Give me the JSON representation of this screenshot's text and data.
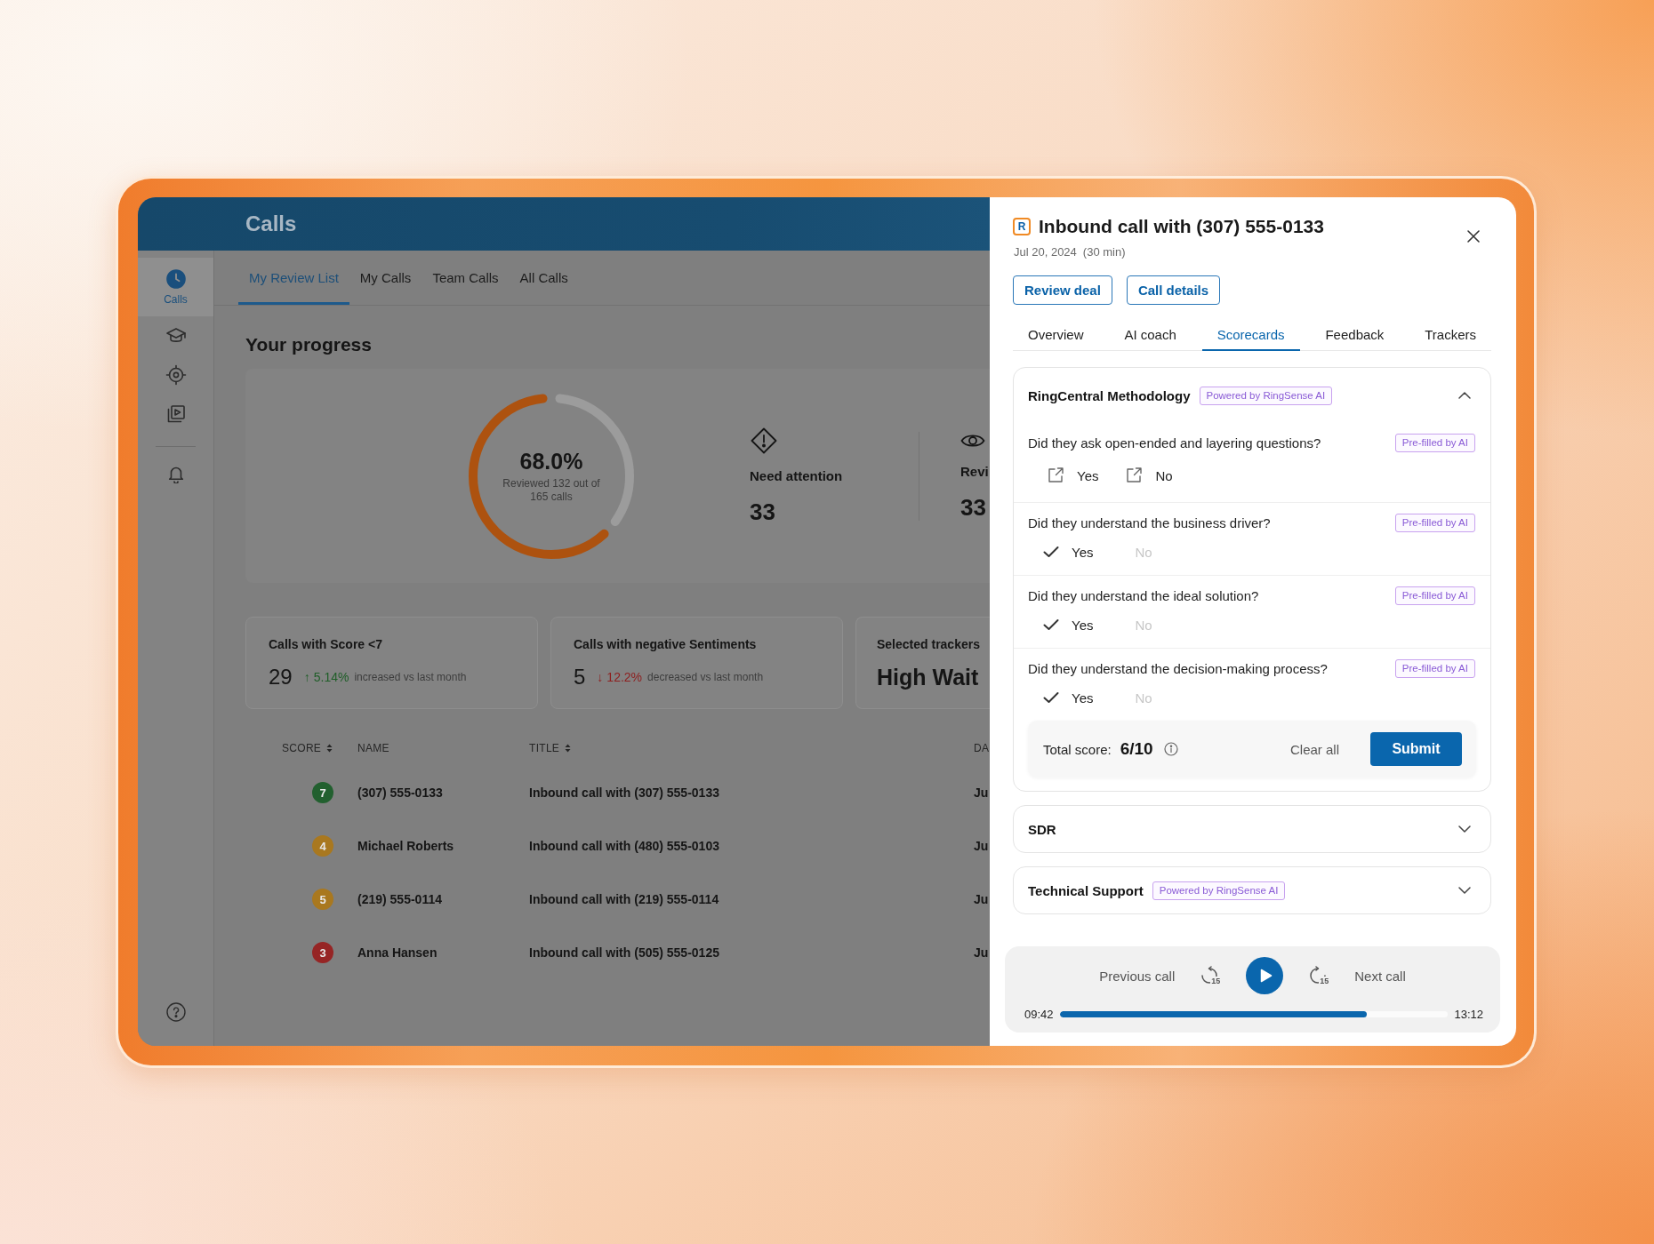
{
  "main_app": {
    "header": {
      "title": "Calls"
    },
    "sidebar": {
      "items": [
        {
          "label": "Calls",
          "selected": true
        },
        {
          "selected": false
        },
        {
          "selected": false
        },
        {
          "selected": false
        }
      ],
      "secondary_items": [
        {
          "selected": false
        }
      ]
    },
    "tabs": [
      {
        "label": "My Review List",
        "selected": true
      },
      {
        "label": "My Calls",
        "selected": false
      },
      {
        "label": "Team Calls",
        "selected": false
      },
      {
        "label": "All Calls",
        "selected": false
      }
    ],
    "progress": {
      "title": "Your progress",
      "ring": {
        "level": 0.6,
        "value": "68.0%",
        "caption": "Reviewed 132 out of 165 calls"
      },
      "stats": [
        {
          "label": "Need attention",
          "value": "33"
        },
        {
          "label": "Revi",
          "value": "33"
        }
      ]
    },
    "metric_cards": [
      {
        "kind": "metric",
        "title": "Calls with Score <7",
        "value": "29",
        "arrow": "↑",
        "change": "5.14%",
        "color": "#1f5e28",
        "note": "increased vs last month"
      },
      {
        "kind": "metric",
        "title": "Calls with negative Sentiments",
        "value": "5",
        "arrow": "↓",
        "change": "12.2%",
        "color": "#8e1f1f",
        "note": "decreased vs last month"
      },
      {
        "kind": "tracker",
        "title": "Selected trackers",
        "value": "High Wait"
      }
    ],
    "table": {
      "columns": [
        {
          "label": "SCORE",
          "sortable": true
        },
        {
          "label": "NAME",
          "sortable": false
        },
        {
          "label": "TITLE",
          "sortable": true
        },
        {
          "label": "DA",
          "sortable": false
        }
      ],
      "rows": [
        {
          "score": "7",
          "color": "#22602f",
          "name": "(307) 555-0133",
          "title": "Inbound call with (307) 555-0133",
          "date": "Ju"
        },
        {
          "score": "4",
          "color": "#a9781f",
          "name": "Michael Roberts",
          "title": "Inbound call with (480) 555-0103",
          "date": "Ju"
        },
        {
          "score": "5",
          "color": "#a9781f",
          "name": "(219) 555-0114",
          "title": "Inbound call with (219) 555-0114",
          "date": "Ju"
        },
        {
          "score": "3",
          "color": "#962525",
          "name": "Anna Hansen",
          "title": "Inbound call with (505) 555-0125",
          "date": "Ju"
        }
      ]
    }
  },
  "call_panel": {
    "logo": "R",
    "title": "Inbound call with (307) 555-0133",
    "date": "Jul 20, 2024",
    "duration": "(30 min)",
    "buttons": [
      "Review deal",
      "Call details"
    ],
    "tabs": [
      {
        "label": "Overview",
        "selected": false
      },
      {
        "label": "AI coach",
        "selected": false
      },
      {
        "label": "Scorecards",
        "selected": true
      },
      {
        "label": "Feedback",
        "selected": false
      },
      {
        "label": "Trackers",
        "selected": false
      }
    ],
    "scorecards": [
      {
        "title": "RingCentral Methodology",
        "badge": "Powered by RingSense AI",
        "expanded": true,
        "questions": [
          {
            "text": "Did they ask open-ended and layering questions?",
            "badge": "Pre-filled by AI",
            "options": [
              {
                "label": "Yes",
                "selected": false
              },
              {
                "label": "No",
                "selected": false
              }
            ]
          },
          {
            "text": "Did they understand the business driver?",
            "badge": "Pre-filled by AI",
            "options": [
              {
                "label": "Yes",
                "selected": true
              },
              {
                "label": "No",
                "selected": false
              }
            ]
          },
          {
            "text": "Did they understand the ideal solution?",
            "badge": "Pre-filled by AI",
            "options": [
              {
                "label": "Yes",
                "selected": true
              },
              {
                "label": "No",
                "selected": false
              }
            ]
          },
          {
            "text": "Did they understand the decision-making process?",
            "badge": "Pre-filled by AI",
            "options": [
              {
                "label": "Yes",
                "selected": true
              },
              {
                "label": "No",
                "selected": false
              }
            ]
          }
        ],
        "total_label": "Total score:",
        "total_value": "6/10",
        "clear": "Clear all",
        "submit": "Submit"
      },
      {
        "title": "SDR",
        "expanded": false
      },
      {
        "title": "Technical Support",
        "badge": "Powered by RingSense AI",
        "expanded": false
      }
    ],
    "player": {
      "previous": "Previous call",
      "back_seconds": "15",
      "forward_seconds": "15",
      "next": "Next call",
      "elapsed": "09:42",
      "level": 0.79,
      "total": "13:12"
    }
  }
}
